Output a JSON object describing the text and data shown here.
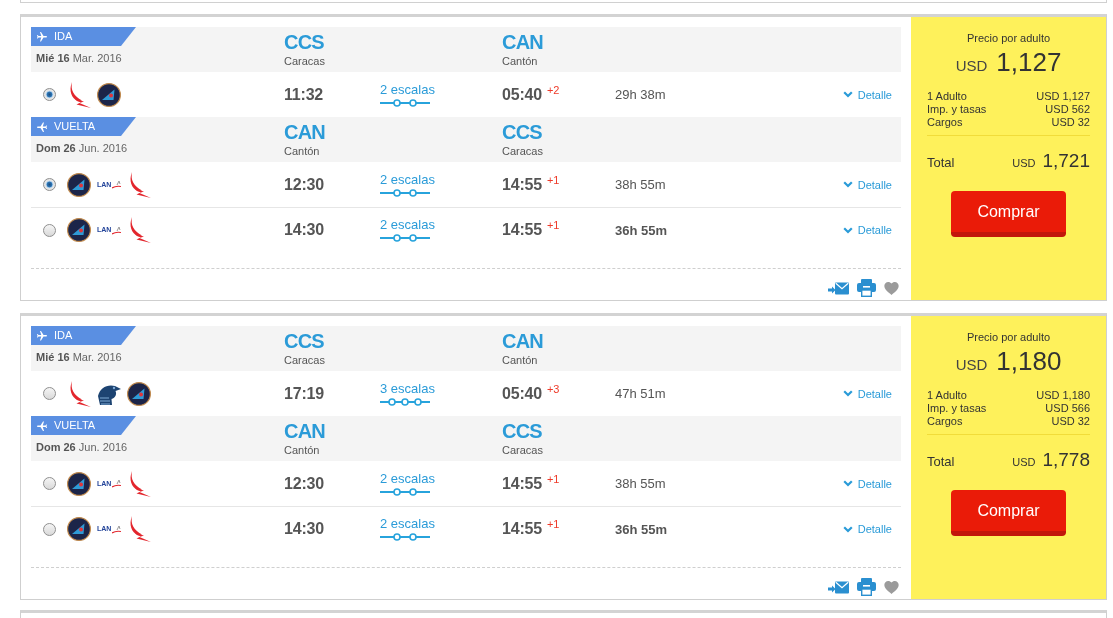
{
  "results": [
    {
      "segments": [
        {
          "kind": "outbound",
          "label": "IDA",
          "date": "**Mié 16** Mar. 2016",
          "origin": {
            "code": "CCS",
            "city": "Caracas"
          },
          "destination": {
            "code": "CAN",
            "city": "Cantón"
          },
          "flights": [
            {
              "selected": true,
              "airlines": [
                {
                  "kind": "wing"
                },
                {
                  "kind": "tail"
                }
              ],
              "departure": "11:32",
              "stops": {
                "label": "2 escalas",
                "points": [
                  {
                    "kind": "layover"
                  },
                  {
                    "kind": "layover"
                  }
                ]
              },
              "arrival": "05:40",
              "day_offset": "+2",
              "duration": "29h 38m",
              "shortest": false,
              "detail": "Detalle"
            }
          ]
        },
        {
          "kind": "return",
          "label": "VUELTA",
          "date": "**Dom 26** Jun. 2016",
          "origin": {
            "code": "CAN",
            "city": "Cantón"
          },
          "destination": {
            "code": "CCS",
            "city": "Caracas"
          },
          "flights": [
            {
              "selected": true,
              "airlines": [
                {
                  "kind": "tail"
                },
                {
                  "kind": "wordmark",
                  "name": "LAN"
                },
                {
                  "kind": "wing"
                }
              ],
              "departure": "12:30",
              "stops": {
                "label": "2 escalas",
                "points": [
                  {
                    "kind": "layover"
                  },
                  {
                    "kind": "layover"
                  }
                ]
              },
              "arrival": "14:55",
              "day_offset": "+1",
              "duration": "38h 55m",
              "shortest": false,
              "detail": "Detalle"
            },
            {
              "selected": false,
              "airlines": [
                {
                  "kind": "tail"
                },
                {
                  "kind": "wordmark",
                  "name": "LAN"
                },
                {
                  "kind": "wing"
                }
              ],
              "departure": "14:30",
              "stops": {
                "label": "2 escalas",
                "points": [
                  {
                    "kind": "layover"
                  },
                  {
                    "kind": "layover"
                  }
                ]
              },
              "arrival": "14:55",
              "day_offset": "+1",
              "duration": "36h 55m",
              "shortest": true,
              "detail": "Detalle"
            }
          ]
        }
      ],
      "price": {
        "caption": "Precio por adulto",
        "currency": "USD",
        "amount": "1,127",
        "breakdown": [
          {
            "label": "1 Adulto",
            "value": "USD 1,127"
          },
          {
            "label": "Imp. y tasas",
            "value": "USD 562"
          },
          {
            "label": "Cargos",
            "value": "USD 32"
          }
        ],
        "total_label": "Total",
        "total_currency": "USD",
        "total_amount": "1,721",
        "button": "Comprar"
      }
    },
    {
      "segments": [
        {
          "kind": "outbound",
          "label": "IDA",
          "date": "**Mié 16** Mar. 2016",
          "origin": {
            "code": "CCS",
            "city": "Caracas"
          },
          "destination": {
            "code": "CAN",
            "city": "Cantón"
          },
          "flights": [
            {
              "selected": false,
              "airlines": [
                {
                  "kind": "wing"
                },
                {
                  "kind": "bird"
                },
                {
                  "kind": "tail"
                }
              ],
              "departure": "17:19",
              "stops": {
                "label": "3 escalas",
                "points": [
                  {
                    "kind": "layover"
                  },
                  {
                    "kind": "layover"
                  },
                  {
                    "kind": "layover"
                  }
                ]
              },
              "arrival": "05:40",
              "day_offset": "+3",
              "duration": "47h 51m",
              "shortest": false,
              "detail": "Detalle"
            }
          ]
        },
        {
          "kind": "return",
          "label": "VUELTA",
          "date": "**Dom 26** Jun. 2016",
          "origin": {
            "code": "CAN",
            "city": "Cantón"
          },
          "destination": {
            "code": "CCS",
            "city": "Caracas"
          },
          "flights": [
            {
              "selected": false,
              "airlines": [
                {
                  "kind": "tail"
                },
                {
                  "kind": "wordmark",
                  "name": "LAN"
                },
                {
                  "kind": "wing"
                }
              ],
              "departure": "12:30",
              "stops": {
                "label": "2 escalas",
                "points": [
                  {
                    "kind": "layover"
                  },
                  {
                    "kind": "layover"
                  }
                ]
              },
              "arrival": "14:55",
              "day_offset": "+1",
              "duration": "38h 55m",
              "shortest": false,
              "detail": "Detalle"
            },
            {
              "selected": false,
              "airlines": [
                {
                  "kind": "tail"
                },
                {
                  "kind": "wordmark",
                  "name": "LAN"
                },
                {
                  "kind": "wing"
                }
              ],
              "departure": "14:30",
              "stops": {
                "label": "2 escalas",
                "points": [
                  {
                    "kind": "layover"
                  },
                  {
                    "kind": "layover"
                  }
                ]
              },
              "arrival": "14:55",
              "day_offset": "+1",
              "duration": "36h 55m",
              "shortest": true,
              "detail": "Detalle"
            }
          ]
        }
      ],
      "price": {
        "caption": "Precio por adulto",
        "currency": "USD",
        "amount": "1,180",
        "breakdown": [
          {
            "label": "1 Adulto",
            "value": "USD 1,180"
          },
          {
            "label": "Imp. y tasas",
            "value": "USD 566"
          },
          {
            "label": "Cargos",
            "value": "USD 32"
          }
        ],
        "total_label": "Total",
        "total_currency": "USD",
        "total_amount": "1,778",
        "button": "Comprar"
      }
    }
  ]
}
